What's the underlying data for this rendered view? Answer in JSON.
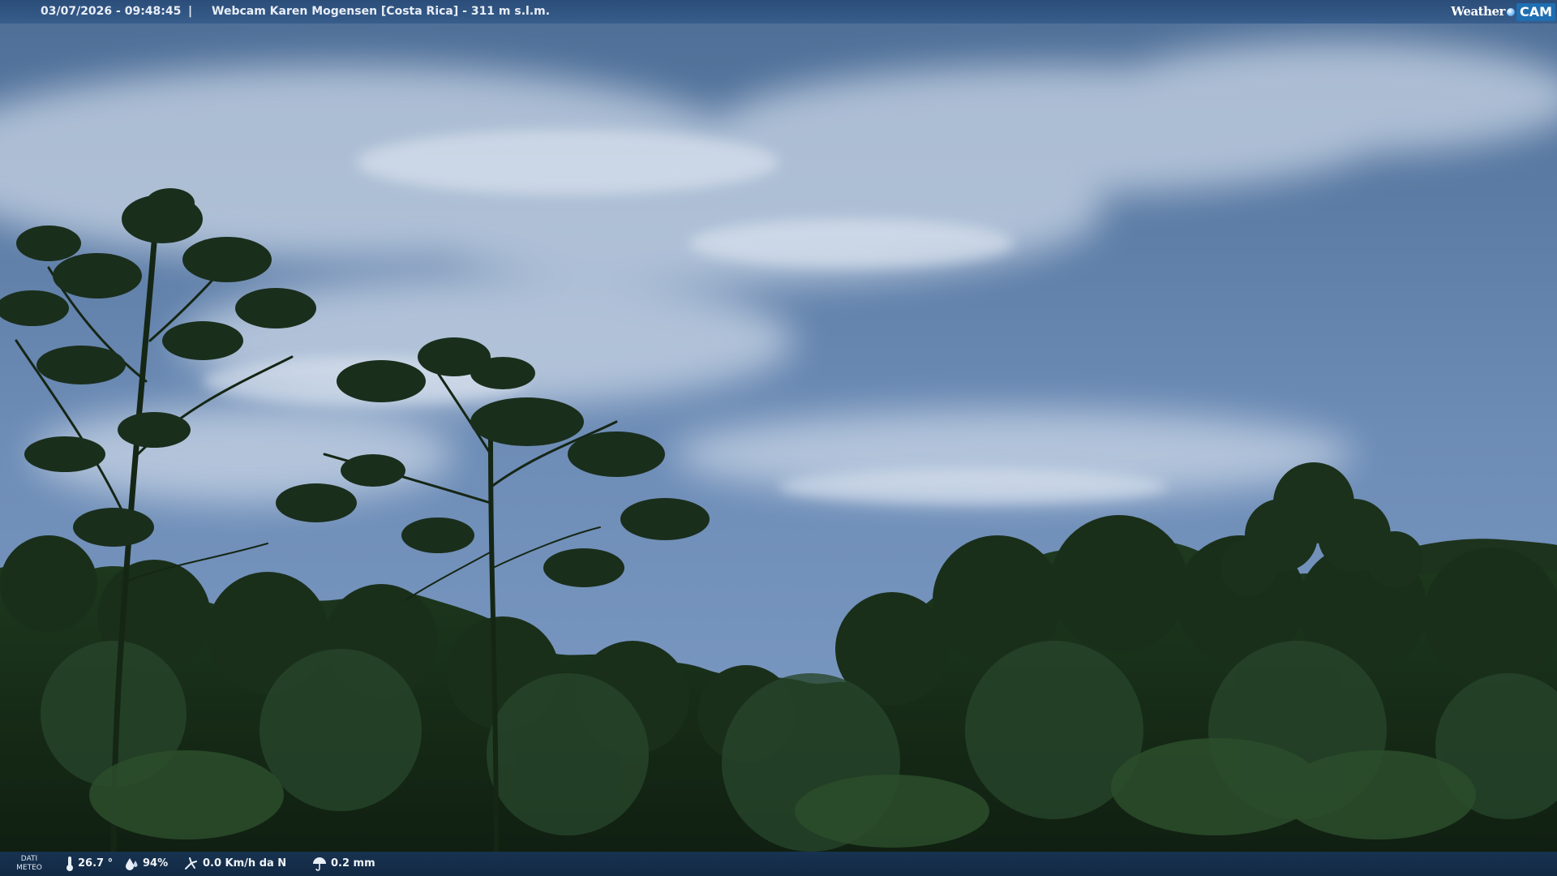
{
  "overlay": {
    "datetime": "03/07/2026 - 09:48:45",
    "separator": "|",
    "title": "Webcam Karen Mogensen [Costa Rica]  - 311 m s.l.m."
  },
  "brand": {
    "weather": "Weather",
    "cam": "CAM"
  },
  "weather_data": {
    "label_line1": "DATI",
    "label_line2": "METEO",
    "temperature": "26.7 °",
    "humidity": "94%",
    "wind": "0.0 Km/h da N",
    "rain": "0.2 mm",
    "icons": {
      "temperature": "thermometer-icon",
      "humidity": "droplets-icon",
      "wind": "wind-icon",
      "rain": "rain-umbrella-icon"
    }
  },
  "colors": {
    "sky_top": "#4a6f9a",
    "sky_bottom": "#7a9ac4",
    "foliage": "#142516",
    "bar": "#2a4a76"
  }
}
